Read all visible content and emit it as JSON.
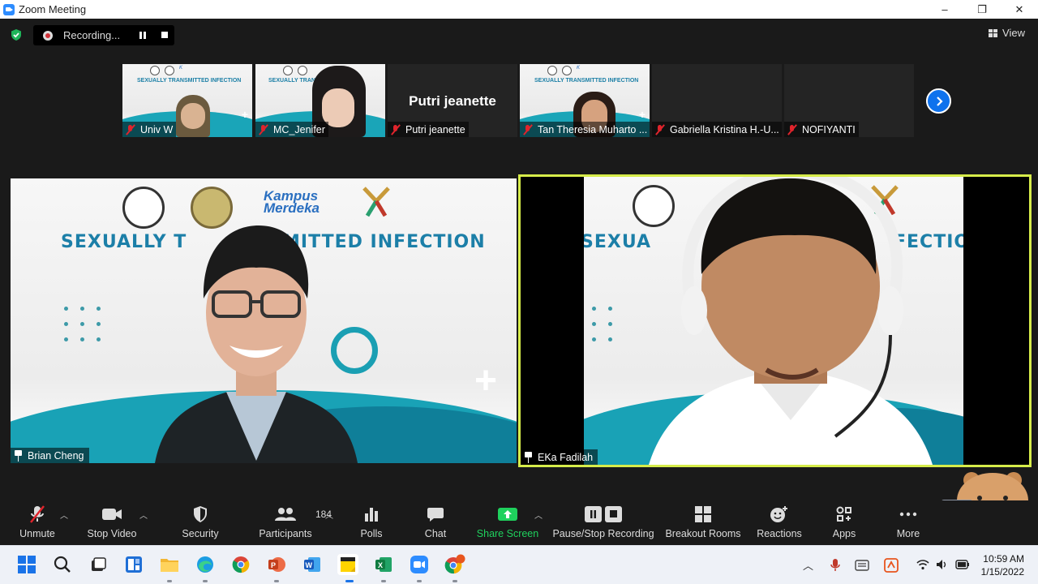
{
  "window": {
    "title": "Zoom Meeting",
    "controls": [
      "–",
      "❐",
      "✕"
    ]
  },
  "meeting_bar": {
    "recording_label": "Recording...",
    "view_label": "View"
  },
  "gallery": [
    {
      "name": "Univ W",
      "muted": true,
      "display_text": ""
    },
    {
      "name": "MC_Jenifer",
      "muted": true,
      "display_text": ""
    },
    {
      "name": "Putri jeanette",
      "muted": true,
      "display_text": "Putri jeanette"
    },
    {
      "name": "Tan Theresia Muharto ...",
      "muted": true,
      "display_text": ""
    },
    {
      "name": "Gabriella Kristina H.-U...",
      "muted": true,
      "display_text": ""
    },
    {
      "name": "NOFIYANTI",
      "muted": true,
      "display_text": ""
    }
  ],
  "slide": {
    "title": "SEXUALLY TRANSMITTED INFECTION",
    "title_left_visible": "SEXUALLY T",
    "title_right_visible": "MITTED INFECTION",
    "title_cut_left": "SEXUA",
    "title_cut_right": "FECTIO",
    "kampus_line1": "Kampus",
    "kampus_line2": "Merdeka",
    "small_title_left": "SEXUALLY TRANS",
    "small_title_right": "MITTED INFECTION"
  },
  "main_videos": [
    {
      "name": "Brian Cheng",
      "pinned": true
    },
    {
      "name": "EKa Fadilah",
      "pinned": true,
      "active_speaker": true
    }
  ],
  "toolbar": {
    "unmute": "Unmute",
    "stop_video": "Stop Video",
    "security": "Security",
    "participants": "Participants",
    "participant_count": "184",
    "polls": "Polls",
    "chat": "Chat",
    "share_screen": "Share Screen",
    "pause_stop_recording": "Pause/Stop Recording",
    "breakout_rooms": "Breakout Rooms",
    "reactions": "Reactions",
    "apps": "Apps",
    "more": "More"
  },
  "taskbar": {
    "time": "10:59 AM",
    "date": "1/15/2022",
    "apps": [
      "start",
      "search",
      "task-view",
      "widgets",
      "file-explorer",
      "edge",
      "chrome",
      "powerpoint",
      "word",
      "sticky-notes",
      "excel",
      "zoom",
      "chrome-profile"
    ]
  },
  "colors": {
    "accent_blue": "#0e72ed",
    "share_green": "#1fd15d",
    "active_speaker": "#d6ec4a",
    "muted_red": "#e0242c",
    "slide_teal": "#19a2b6"
  }
}
